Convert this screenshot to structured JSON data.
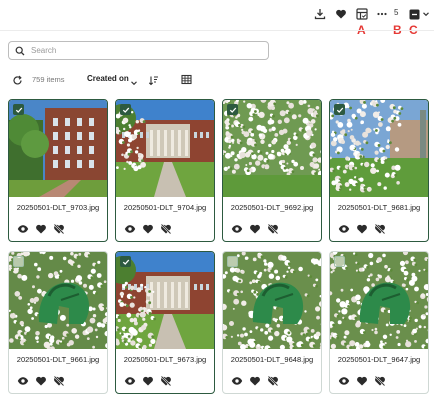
{
  "toolbar": {
    "icons": [
      "download-icon",
      "heart-icon",
      "gallery-grid-icon",
      "more-icon",
      "selection-toggle-icon",
      "chevron-down-icon"
    ],
    "selected_count": "5",
    "annotations": [
      "A",
      "B",
      "C"
    ]
  },
  "search": {
    "placeholder": "Search",
    "value": ""
  },
  "controls": {
    "refresh_icon": "refresh-icon",
    "items_count": "759 items",
    "sort_label": "Created on",
    "sort_direction_icon": "sort-direction-icon",
    "view_icon": "grid-view-icon"
  },
  "colors": {
    "accent": "#2d5a40",
    "annotation": "#e53935",
    "card_border": "#cfd8d4"
  },
  "cards": [
    {
      "filename": "20250501-DLT_9703.jpg",
      "selected": true,
      "image": "brick building with walkway"
    },
    {
      "filename": "20250501-DLT_9704.jpg",
      "selected": true,
      "image": "columned building with trees"
    },
    {
      "filename": "20250501-DLT_9692.jpg",
      "selected": true,
      "image": "blossoming trees"
    },
    {
      "filename": "20250501-DLT_9681.jpg",
      "selected": true,
      "image": "blossoms with building"
    },
    {
      "filename": "20250501-DLT_9661.jpg",
      "selected": false,
      "image": "spartan statue with blossoms"
    },
    {
      "filename": "20250501-DLT_9673.jpg",
      "selected": true,
      "image": "columned building with blossoms"
    },
    {
      "filename": "20250501-DLT_9648.jpg",
      "selected": false,
      "image": "spartan statue with blossoms"
    },
    {
      "filename": "20250501-DLT_9647.jpg",
      "selected": false,
      "image": "spartan statue with blossoms"
    }
  ],
  "card_actions": [
    "view-icon",
    "favorite-icon",
    "unfavorite-icon"
  ]
}
